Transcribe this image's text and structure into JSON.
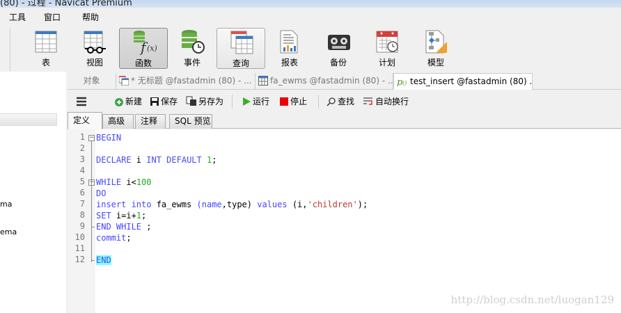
{
  "window": {
    "title": "(80) - 过程 - Navicat Premium"
  },
  "menu": [
    "工具",
    "窗口",
    "帮助"
  ],
  "toolbar": [
    {
      "label": "表",
      "icon": "table-icon"
    },
    {
      "label": "视图",
      "icon": "view-icon"
    },
    {
      "label": "函数",
      "icon": "function-icon",
      "active": true
    },
    {
      "label": "事件",
      "icon": "event-icon"
    },
    {
      "label": "查询",
      "icon": "query-icon"
    },
    {
      "label": "报表",
      "icon": "report-icon"
    },
    {
      "label": "备份",
      "icon": "backup-icon"
    },
    {
      "label": "计划",
      "icon": "schedule-icon"
    },
    {
      "label": "模型",
      "icon": "model-icon"
    }
  ],
  "sidebar": {
    "items": [
      "ma",
      "ema"
    ]
  },
  "tabs": [
    "对象",
    "* 无标题 @fastadmin (80) - ...",
    "fa_ewms @fastadmin (80) - ...",
    "test_insert @fastadmin (80) ..."
  ],
  "editor_toolbar": {
    "new": "新建",
    "save": "保存",
    "save_as": "另存为",
    "run": "运行",
    "stop": "停止",
    "find": "查找",
    "wrap": "自动换行"
  },
  "subtabs": [
    "定义",
    "高级",
    "注释",
    "SQL 预览"
  ],
  "code": [
    [
      [
        "kw",
        "BEGIN"
      ]
    ],
    [],
    [
      [
        "kw",
        "DECLARE"
      ],
      [
        "id",
        " i "
      ],
      [
        "kw",
        "INT DEFAULT"
      ],
      [
        "id",
        " "
      ],
      [
        "num",
        "1"
      ],
      [
        "id",
        ";"
      ]
    ],
    [],
    [
      [
        "kw",
        "WHILE"
      ],
      [
        "id",
        " i<"
      ],
      [
        "num",
        "100"
      ]
    ],
    [
      [
        "kw",
        "DO"
      ]
    ],
    [
      [
        "kw",
        "insert into"
      ],
      [
        "id",
        " fa_ewms "
      ],
      [
        "kw",
        "("
      ],
      [
        "kw",
        "name"
      ],
      [
        "id",
        ",type) "
      ],
      [
        "kw",
        "values"
      ],
      [
        "id",
        " (i,"
      ],
      [
        "str",
        "'children'"
      ],
      [
        "id",
        ");"
      ]
    ],
    [
      [
        "kw",
        "SET"
      ],
      [
        "id",
        " i=i+"
      ],
      [
        "num",
        "1"
      ],
      [
        "id",
        ";"
      ]
    ],
    [
      [
        "kw",
        "END WHILE"
      ],
      [
        "id",
        " ;"
      ]
    ],
    [
      [
        "kw",
        "commit"
      ],
      [
        "id",
        ";"
      ]
    ],
    [],
    [
      [
        "kw",
        "END"
      ]
    ]
  ],
  "watermark": "http://blog.csdn.net/luogan129"
}
